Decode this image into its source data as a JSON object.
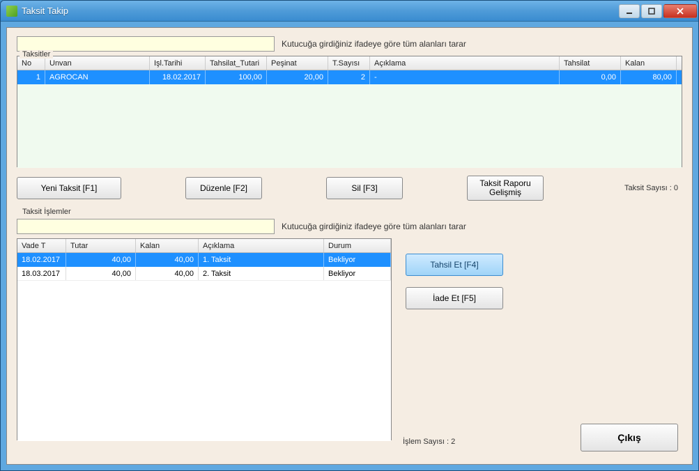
{
  "window": {
    "title": "Taksit Takip"
  },
  "search": {
    "hint": "Kutucuğa girdiğiniz ifadeye göre tüm alanları tarar"
  },
  "group1": {
    "label": "Taksitler",
    "headers": {
      "no": "No",
      "unvan": "Unvan",
      "tarih": "Işl.Tarihi",
      "tutar": "Tahsilat_Tutari",
      "pesinat": "Peşinat",
      "tsayi": "T.Sayısı",
      "aciklama": "Açıklama",
      "tahsilat": "Tahsilat",
      "kalan": "Kalan"
    },
    "rows": [
      {
        "no": "1",
        "unvan": "AGROCAN",
        "tarih": "18.02.2017",
        "tutar": "100,00",
        "pesinat": "20,00",
        "tsayi": "2",
        "aciklama": "-",
        "tahsilat": "0,00",
        "kalan": "80,00"
      }
    ]
  },
  "buttons": {
    "yeni": "Yeni Taksit [F1]",
    "duzenle": "Düzenle [F2]",
    "sil": "Sil [F3]",
    "rapor_l1": "Taksit Raporu",
    "rapor_l2": "Gelişmiş",
    "tahsil": "Tahsil Et [F4]",
    "iade": "İade Et [F5]",
    "cikis": "Çıkış"
  },
  "counts": {
    "taksit": "Taksit Sayısı : 0",
    "islem": "İşlem Sayısı : 2"
  },
  "group2": {
    "label": "Taksit İşlemler",
    "headers": {
      "vade": "Vade T",
      "tutar": "Tutar",
      "kalan": "Kalan",
      "aciklama": "Açıklama",
      "durum": "Durum"
    },
    "rows": [
      {
        "vade": "18.02.2017",
        "tutar": "40,00",
        "kalan": "40,00",
        "aciklama": "1. Taksit",
        "durum": "Bekliyor",
        "selected": true
      },
      {
        "vade": "18.03.2017",
        "tutar": "40,00",
        "kalan": "40,00",
        "aciklama": "2. Taksit",
        "durum": "Bekliyor",
        "selected": false
      }
    ]
  }
}
